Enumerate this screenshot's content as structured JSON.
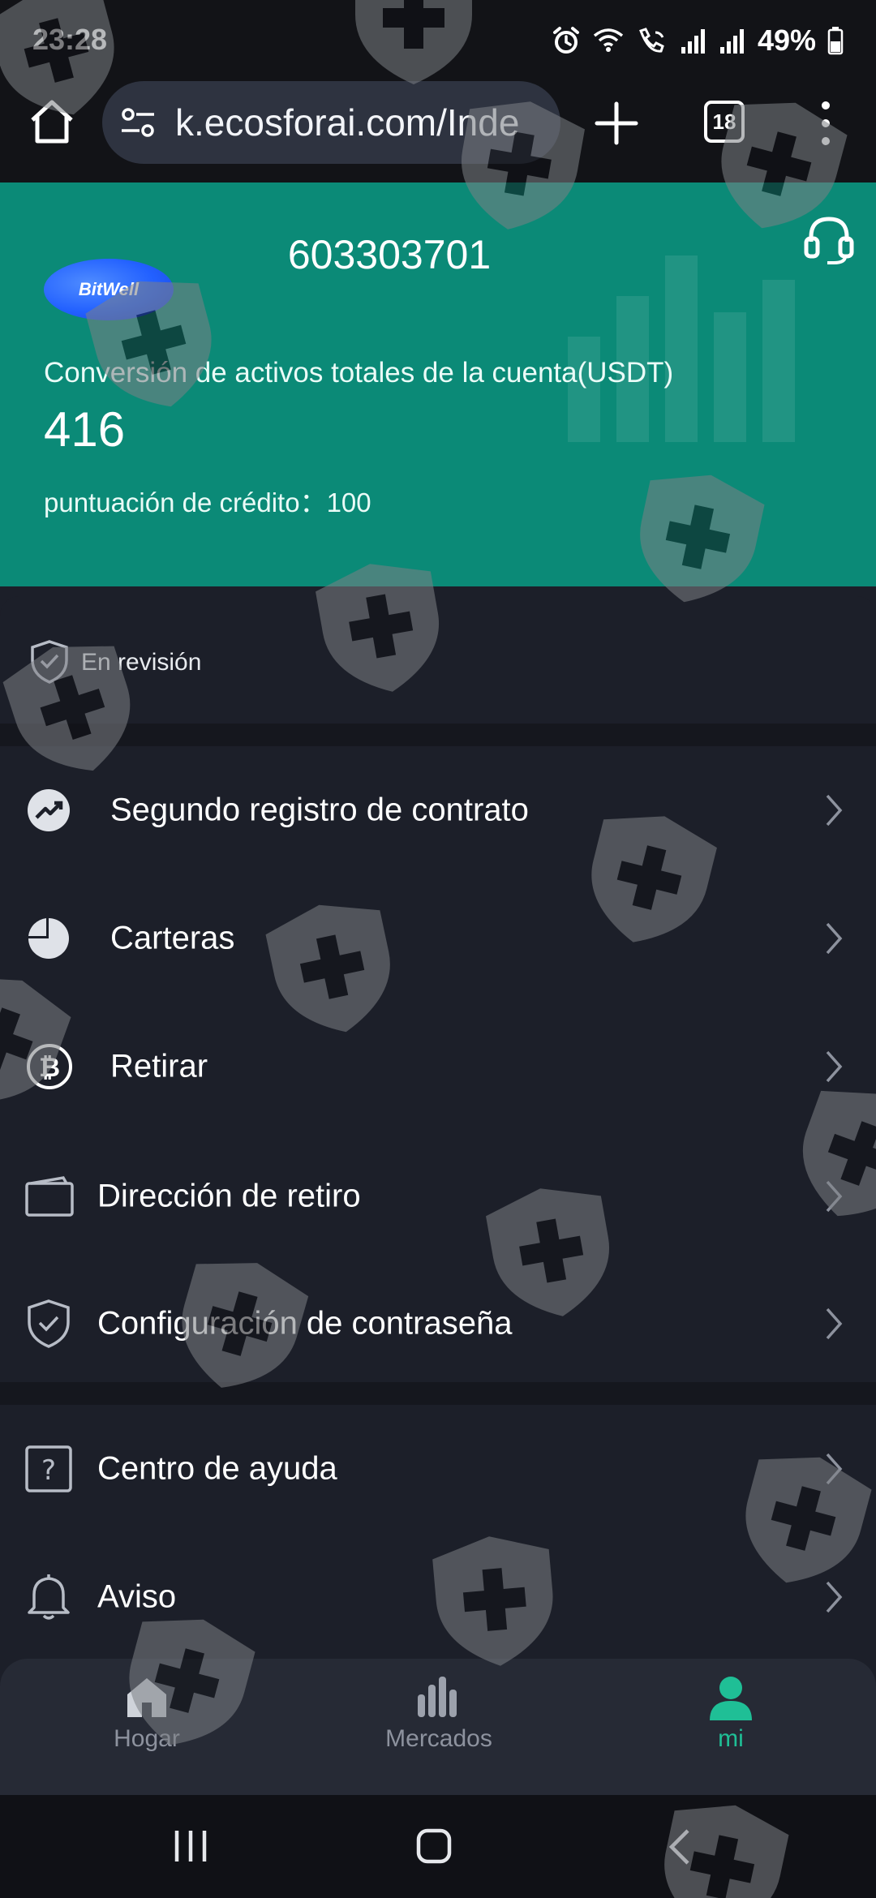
{
  "status_bar": {
    "time": "23:28",
    "battery_percent": "49%",
    "icons": [
      "alarm-icon",
      "wifi-icon",
      "wifi-calling-icon",
      "signal-icon",
      "signal-icon",
      "battery-icon"
    ]
  },
  "browser": {
    "url": "k.ecosforai.com/Inde",
    "tab_count": "18",
    "icons": [
      "home-icon",
      "site-settings-icon",
      "new-tab-icon",
      "menu-icon"
    ]
  },
  "header": {
    "brand_logo_text": "BitWell",
    "uid": "603303701",
    "assets_label": "Conversión de activos totales de la cuenta(USDT)",
    "assets_value": "416",
    "credit_label": "puntuación de crédito",
    "credit_separator": "：",
    "credit_value": "100",
    "icons": [
      "headset-icon"
    ],
    "colors": {
      "header_bg": "#0b8a77",
      "logo_blue": "#2260ff"
    }
  },
  "review": {
    "text": "En revisión",
    "icon": "shield-check-icon"
  },
  "menu": {
    "group1": [
      {
        "label": "Segundo registro de contrato",
        "icon": "trend-up-icon"
      },
      {
        "label": "Carteras",
        "icon": "pie-chart-icon"
      },
      {
        "label": "Retirar",
        "icon": "bitcoin-icon"
      },
      {
        "label": "Dirección de retiro",
        "icon": "wallet-icon"
      },
      {
        "label": "Configuración de contraseña",
        "icon": "shield-check-icon"
      }
    ],
    "group2": [
      {
        "label": "Centro de ayuda",
        "icon": "help-icon"
      },
      {
        "label": "Aviso",
        "icon": "bell-icon"
      }
    ]
  },
  "bottom_nav": [
    {
      "label": "Hogar",
      "icon": "home-icon"
    },
    {
      "label": "Mercados",
      "icon": "bar-chart-icon"
    },
    {
      "label": "mi",
      "icon": "user-icon",
      "active": true
    }
  ],
  "theme": {
    "page_bg": "#1c1f29",
    "active_green": "#1fbf96",
    "text_primary": "#ffffff",
    "text_muted": "#8d929e",
    "watermark": "#7d8085"
  }
}
